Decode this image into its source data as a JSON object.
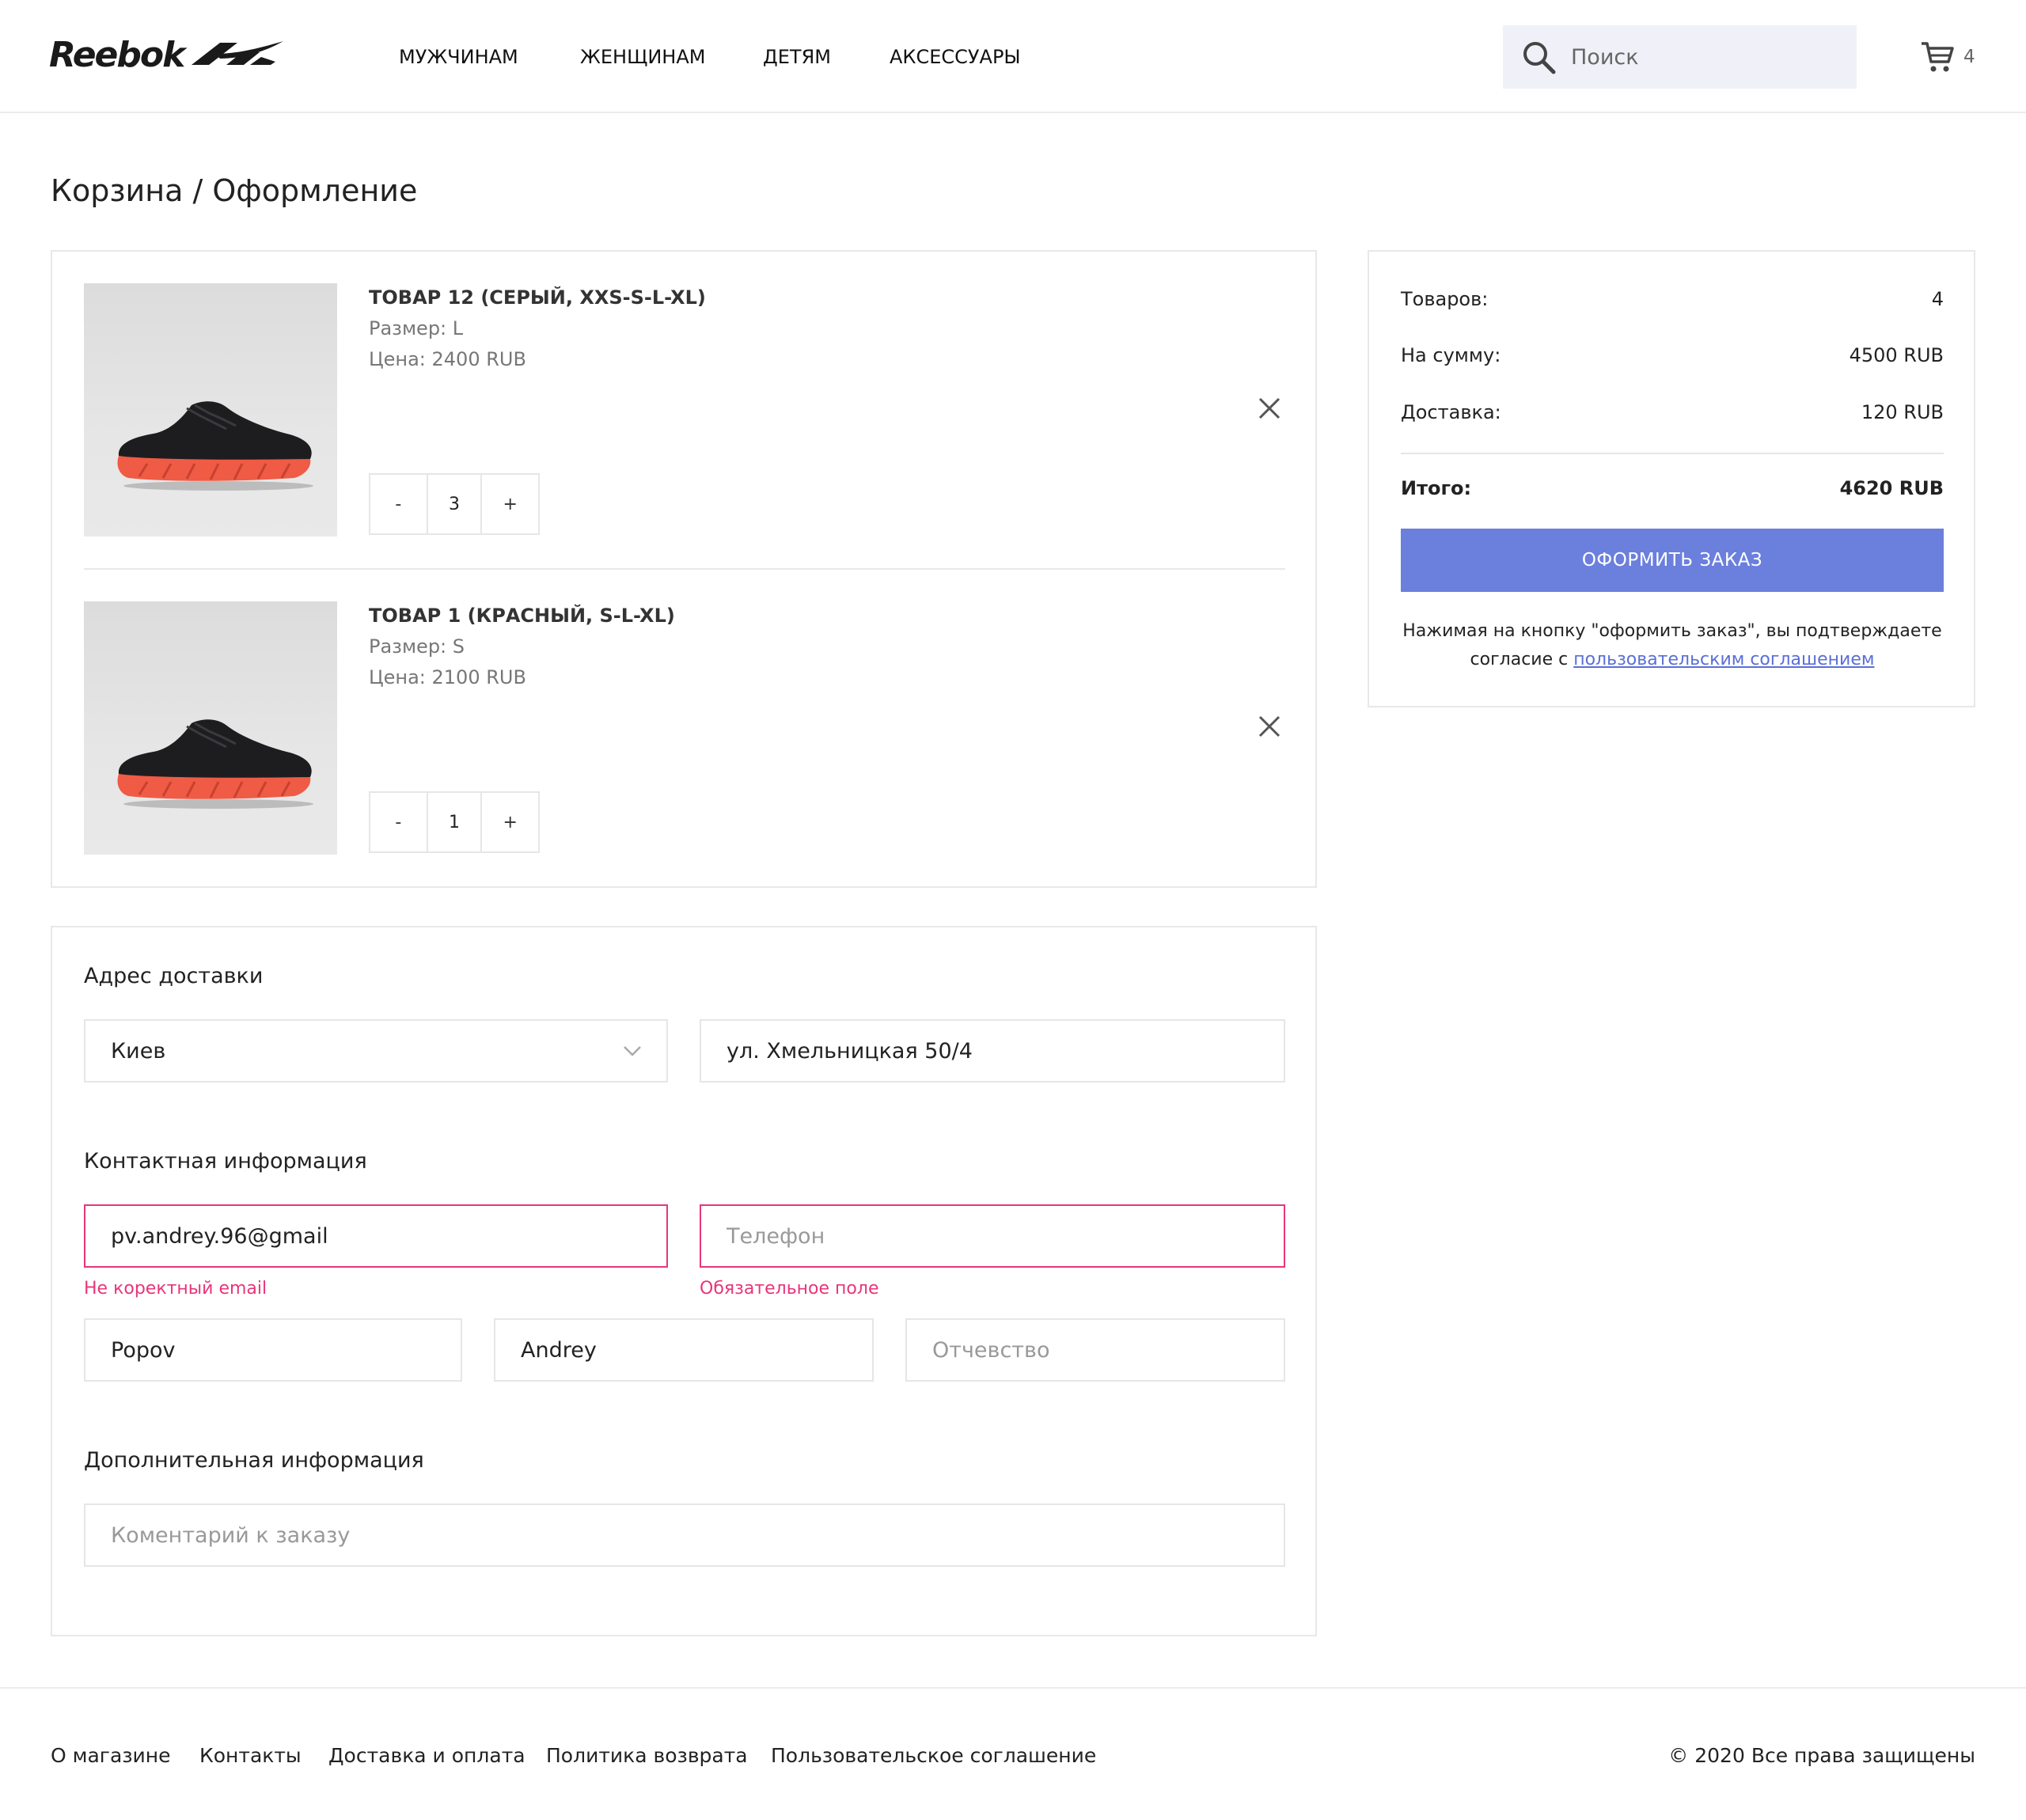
{
  "header": {
    "logo_text": "Reebok",
    "nav": [
      "МУЖЧИНАМ",
      "ЖЕНЩИНАМ",
      "ДЕТЯМ",
      "АКСЕССУАРЫ"
    ],
    "search_placeholder": "Поиск",
    "cart_count": "4"
  },
  "page_title": "Корзина / Оформление",
  "cart_items": [
    {
      "title": "ТОВАР 12 (СЕРЫЙ, XXS-S-L-XL)",
      "size": "Размер: L",
      "price": "Цена: 2400 RUB",
      "qty_minus": "-",
      "qty": "3",
      "qty_plus": "+"
    },
    {
      "title": "ТОВАР 1 (КРАСНЫЙ, S-L-XL)",
      "size": "Размер: S",
      "price": "Цена: 2100 RUB",
      "qty_minus": "-",
      "qty": "1",
      "qty_plus": "+"
    }
  ],
  "summary": {
    "items_label": "Товаров:",
    "items_value": "4",
    "sum_label": "На сумму:",
    "sum_value": "4500 RUB",
    "delivery_label": "Доставка:",
    "delivery_value": "120 RUB",
    "total_label": "Итого:",
    "total_value": "4620 RUB",
    "order_button": "ОФОРМИТЬ ЗАКАЗ",
    "note_text": "Нажимая на кнопку \"оформить заказ\", вы подтверждаете согласие с ",
    "note_link": "пользовательским соглашением"
  },
  "form": {
    "address_title": "Адрес доставки",
    "city_value": "Киев",
    "street_value": "ул. Хмельницкая 50/4",
    "contact_title": "Контактная информация",
    "email_value": "pv.andrey.96@gmail",
    "email_error": "Не коректный email",
    "phone_placeholder": "Телефон",
    "phone_error": "Обязательное поле",
    "last_name_value": "Popov",
    "first_name_value": "Andrey",
    "patronymic_placeholder": "Отчевство",
    "extra_title": "Дополнительная информация",
    "comment_placeholder": "Коментарий к заказу"
  },
  "footer": {
    "links": [
      "О магазине",
      "Контакты",
      "Доставка и оплата",
      "Политика возврата",
      "Пользовательское соглашение"
    ],
    "copyright": "© 2020 Все права защищены"
  },
  "colors": {
    "accent": "#6b7fdd",
    "error": "#e8357a",
    "search_bg": "#f0f1f8"
  },
  "icons": [
    "reebok-delta-icon",
    "search-icon",
    "cart-icon",
    "close-icon",
    "chevron-down-icon"
  ]
}
